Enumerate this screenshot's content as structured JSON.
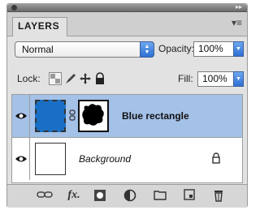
{
  "panel": {
    "tab_label": "LAYERS",
    "menu_glyph": "▾≡"
  },
  "blend": {
    "mode": "Normal",
    "opacity_label": "Opacity:",
    "opacity_value": "100%"
  },
  "locks": {
    "lock_label": "Lock:",
    "fill_label": "Fill:",
    "fill_value": "100%"
  },
  "layers": [
    {
      "name": "Blue rectangle",
      "visible": true,
      "selected": true,
      "thumb_color": "#1a6fc4"
    },
    {
      "name": "Background",
      "visible": true,
      "selected": false,
      "locked": true,
      "thumb_color": "#ffffff"
    }
  ],
  "footer": {
    "icons": [
      "link-layers-icon",
      "fx-icon",
      "add-mask-icon",
      "adjustment-layer-icon",
      "new-group-icon",
      "new-layer-icon",
      "delete-layer-icon"
    ],
    "fx_label": "fx."
  },
  "colors": {
    "selection": "#a4c1e8",
    "accent_blue": "#2d6fd4"
  }
}
